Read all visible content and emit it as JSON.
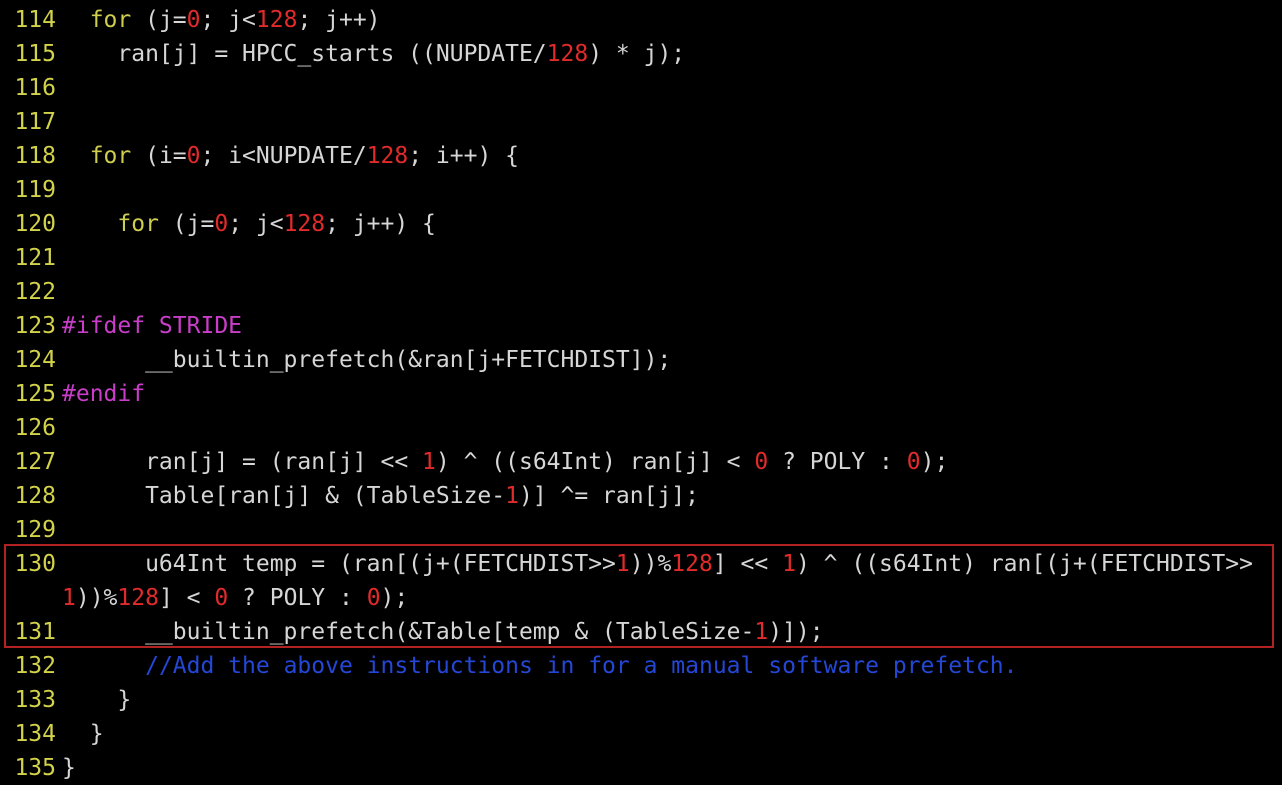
{
  "editor": {
    "highlight_color": "#b22222",
    "colors": {
      "line_number": "#d2d24b",
      "keyword": "#cdcd50",
      "number": "#e12b2b",
      "preprocessor": "#c93ec9",
      "comment": "#2447d6",
      "text": "#d6d6d6",
      "background": "#000000"
    },
    "lines": [
      {
        "n": "114",
        "tokens": [
          {
            "t": "txt",
            "v": "  "
          },
          {
            "t": "kw",
            "v": "for"
          },
          {
            "t": "txt",
            "v": " (j="
          },
          {
            "t": "num",
            "v": "0"
          },
          {
            "t": "txt",
            "v": "; j<"
          },
          {
            "t": "num",
            "v": "128"
          },
          {
            "t": "txt",
            "v": "; j++)"
          }
        ]
      },
      {
        "n": "115",
        "tokens": [
          {
            "t": "txt",
            "v": "    ran[j] = HPCC_starts ((NUPDATE/"
          },
          {
            "t": "num",
            "v": "128"
          },
          {
            "t": "txt",
            "v": ") * j);"
          }
        ]
      },
      {
        "n": "116",
        "tokens": []
      },
      {
        "n": "117",
        "tokens": []
      },
      {
        "n": "118",
        "tokens": [
          {
            "t": "txt",
            "v": "  "
          },
          {
            "t": "kw",
            "v": "for"
          },
          {
            "t": "txt",
            "v": " (i="
          },
          {
            "t": "num",
            "v": "0"
          },
          {
            "t": "txt",
            "v": "; i<NUPDATE/"
          },
          {
            "t": "num",
            "v": "128"
          },
          {
            "t": "txt",
            "v": "; i++) {"
          }
        ]
      },
      {
        "n": "119",
        "tokens": []
      },
      {
        "n": "120",
        "tokens": [
          {
            "t": "txt",
            "v": "    "
          },
          {
            "t": "kw",
            "v": "for"
          },
          {
            "t": "txt",
            "v": " (j="
          },
          {
            "t": "num",
            "v": "0"
          },
          {
            "t": "txt",
            "v": "; j<"
          },
          {
            "t": "num",
            "v": "128"
          },
          {
            "t": "txt",
            "v": "; j++) {"
          }
        ]
      },
      {
        "n": "121",
        "tokens": []
      },
      {
        "n": "122",
        "tokens": []
      },
      {
        "n": "123",
        "tokens": [
          {
            "t": "pp",
            "v": "#ifdef STRIDE"
          }
        ]
      },
      {
        "n": "124",
        "tokens": [
          {
            "t": "txt",
            "v": "      __builtin_prefetch(&ran[j+FETCHDIST]);"
          }
        ]
      },
      {
        "n": "125",
        "tokens": [
          {
            "t": "pp",
            "v": "#endif"
          }
        ]
      },
      {
        "n": "126",
        "tokens": []
      },
      {
        "n": "127",
        "tokens": [
          {
            "t": "txt",
            "v": "      ran[j] = (ran[j] << "
          },
          {
            "t": "num",
            "v": "1"
          },
          {
            "t": "txt",
            "v": ") ^ ((s64Int) ran[j] < "
          },
          {
            "t": "num",
            "v": "0"
          },
          {
            "t": "txt",
            "v": " ? POLY : "
          },
          {
            "t": "num",
            "v": "0"
          },
          {
            "t": "txt",
            "v": ");"
          }
        ]
      },
      {
        "n": "128",
        "tokens": [
          {
            "t": "txt",
            "v": "      Table[ran[j] & (TableSize-"
          },
          {
            "t": "num",
            "v": "1"
          },
          {
            "t": "txt",
            "v": ")] ^= ran[j];"
          }
        ]
      },
      {
        "n": "129",
        "tokens": []
      },
      {
        "n": "130",
        "tokens": [
          {
            "t": "txt",
            "v": "      u64Int temp = (ran[(j+(FETCHDIST>>"
          },
          {
            "t": "num",
            "v": "1"
          },
          {
            "t": "txt",
            "v": "))%"
          },
          {
            "t": "num",
            "v": "128"
          },
          {
            "t": "txt",
            "v": "] << "
          },
          {
            "t": "num",
            "v": "1"
          },
          {
            "t": "txt",
            "v": ") ^ ((s64Int) ran[(j+(FETCHDIST>>"
          }
        ]
      },
      {
        "n": "",
        "tokens": [
          {
            "t": "num",
            "v": "1"
          },
          {
            "t": "txt",
            "v": "))%"
          },
          {
            "t": "num",
            "v": "128"
          },
          {
            "t": "txt",
            "v": "] < "
          },
          {
            "t": "num",
            "v": "0"
          },
          {
            "t": "txt",
            "v": " ? POLY : "
          },
          {
            "t": "num",
            "v": "0"
          },
          {
            "t": "txt",
            "v": ");"
          }
        ]
      },
      {
        "n": "131",
        "tokens": [
          {
            "t": "txt",
            "v": "      __builtin_prefetch(&Table[temp & (TableSize-"
          },
          {
            "t": "num",
            "v": "1"
          },
          {
            "t": "txt",
            "v": ")]);"
          }
        ]
      },
      {
        "n": "132",
        "tokens": [
          {
            "t": "txt",
            "v": "      "
          },
          {
            "t": "cmt",
            "v": "//Add the above instructions in for a manual software prefetch."
          }
        ]
      },
      {
        "n": "133",
        "tokens": [
          {
            "t": "txt",
            "v": "    }"
          }
        ]
      },
      {
        "n": "134",
        "tokens": [
          {
            "t": "txt",
            "v": "  }"
          }
        ]
      },
      {
        "n": "135",
        "tokens": [
          {
            "t": "txt",
            "v": "}"
          }
        ]
      }
    ]
  }
}
